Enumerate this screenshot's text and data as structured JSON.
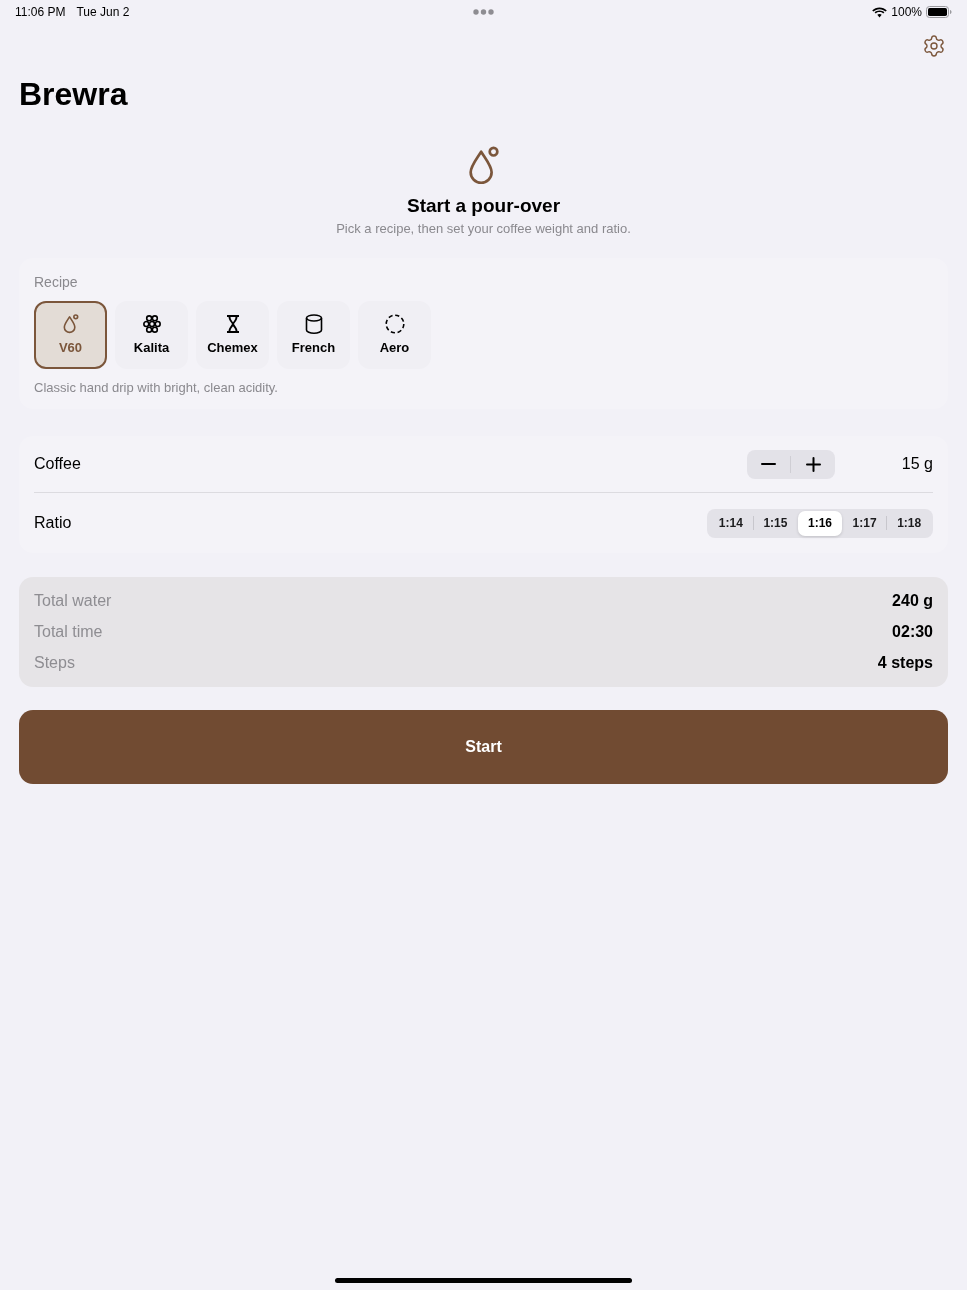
{
  "status_bar": {
    "time": "11:06 PM",
    "date": "Tue Jun 2",
    "battery": "100%"
  },
  "header": {
    "title": "Brewra"
  },
  "hero": {
    "title": "Start a pour-over",
    "subtitle": "Pick a recipe, then set your coffee weight and ratio."
  },
  "recipe": {
    "label": "Recipe",
    "options": [
      {
        "label": "V60",
        "selected": true
      },
      {
        "label": "Kalita",
        "selected": false
      },
      {
        "label": "Chemex",
        "selected": false
      },
      {
        "label": "French",
        "selected": false
      },
      {
        "label": "Aero",
        "selected": false
      }
    ],
    "description": "Classic hand drip with bright, clean acidity."
  },
  "coffee": {
    "label": "Coffee",
    "value": "15 g"
  },
  "ratio": {
    "label": "Ratio",
    "options": [
      {
        "label": "1:14",
        "selected": false
      },
      {
        "label": "1:15",
        "selected": false
      },
      {
        "label": "1:16",
        "selected": true
      },
      {
        "label": "1:17",
        "selected": false
      },
      {
        "label": "1:18",
        "selected": false
      }
    ]
  },
  "summary": [
    {
      "label": "Total water",
      "value": "240 g"
    },
    {
      "label": "Total time",
      "value": "02:30"
    },
    {
      "label": "Steps",
      "value": "4 steps"
    }
  ],
  "start_button": {
    "label": "Start"
  }
}
